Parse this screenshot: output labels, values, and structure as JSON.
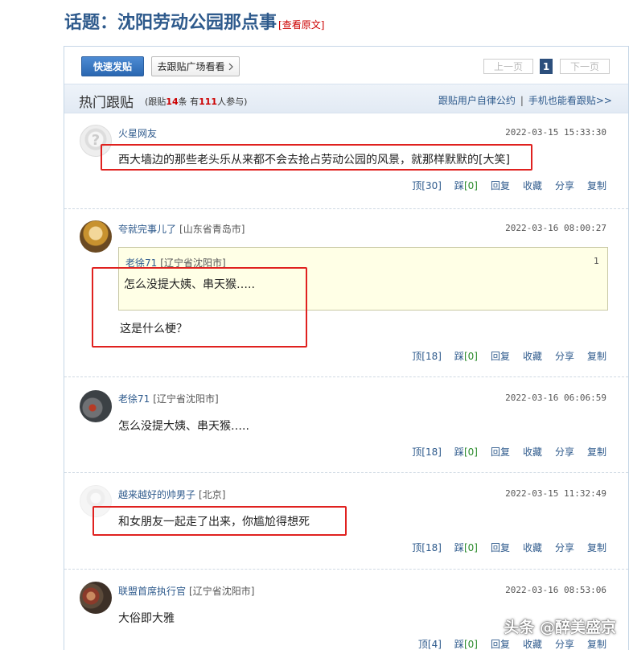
{
  "topic": {
    "title": "话题：沈阳劳动公园那点事",
    "view_original": "[查看原文]"
  },
  "toolbar": {
    "quick_post": "快速发贴",
    "go_plaza": "去跟贴广场看看",
    "prev": "上一页",
    "page": "1",
    "next": "下一页"
  },
  "hot": {
    "title": "热门跟贴",
    "stats_prefix": "(跟贴",
    "posts_count": "14",
    "stats_mid": "条 有",
    "people_count": "111",
    "stats_suffix": "人参与)",
    "link_rules": "跟贴用户自律公约",
    "link_mobile": "手机也能看跟贴>>"
  },
  "actions_labels": {
    "dig_down": "踩",
    "reply": "回复",
    "fav": "收藏",
    "share": "分享",
    "copy": "复制"
  },
  "posts": [
    {
      "user": "火星网友",
      "location": "",
      "time": "2022-03-15 15:33:30",
      "content": "西大墙边的那些老头乐从来都不会去抢占劳动公园的风景，就那样默默的[大笑]",
      "up": "顶[30]",
      "down": "[0]"
    },
    {
      "user": "夸就完事儿了",
      "location": "[山东省青岛市]",
      "time": "2022-03-16 08:00:27",
      "quote_user": "老徐71",
      "quote_location": "[辽宁省沈阳市]",
      "quote_floor": "1",
      "quote_text": "怎么没提大姨、串天猴…..",
      "content": "这是什么梗？",
      "up": "顶[18]",
      "down": "[0]"
    },
    {
      "user": "老徐71",
      "location": "[辽宁省沈阳市]",
      "time": "2022-03-16 06:06:59",
      "content": "怎么没提大姨、串天猴…..",
      "up": "顶[18]",
      "down": "[0]"
    },
    {
      "user": "越来越好的帅男子",
      "location": "[北京]",
      "time": "2022-03-15 11:32:49",
      "content": "和女朋友一起走了出来，你尴尬得想死",
      "up": "顶[18]",
      "down": "[0]"
    },
    {
      "user": "联盟首席执行官",
      "location": "[辽宁省沈阳市]",
      "time": "2022-03-16 08:53:06",
      "content": "大俗即大雅",
      "up": "顶[4]",
      "down": "[0]"
    }
  ],
  "watermark": "头条 @醉美盛京"
}
